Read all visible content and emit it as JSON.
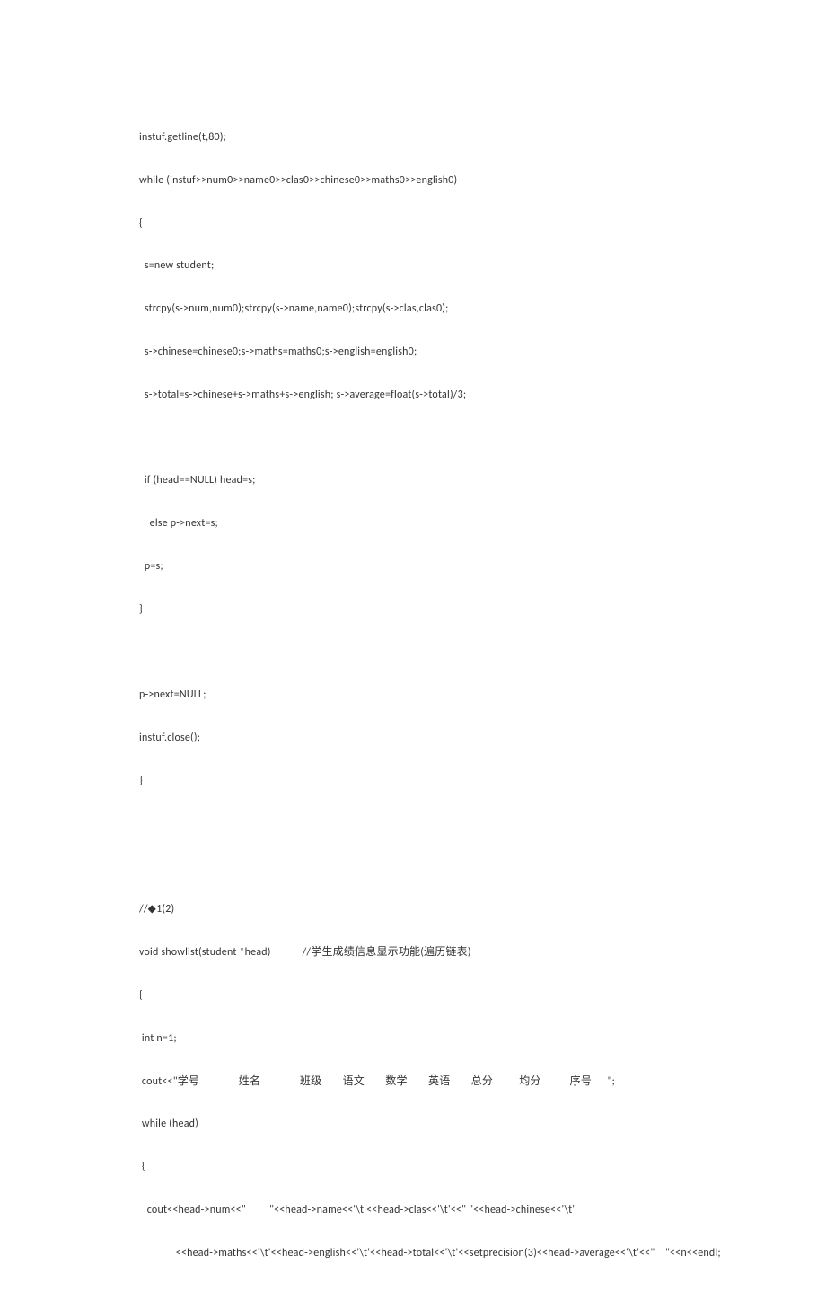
{
  "lines": [
    "instuf.getline(t,80);",
    "while (instuf>>num0>>name0>>clas0>>chinese0>>maths0>>english0)",
    "{",
    "  s=new student;",
    "  strcpy(s->num,num0);strcpy(s->name,name0);strcpy(s->clas,clas0);",
    "  s->chinese=chinese0;s->maths=maths0;s->english=english0;",
    "  s->total=s->chinese+s->maths+s->english; s->average=float(s->total)/3;",
    "",
    "  if (head==NULL) head=s;",
    "    else p->next=s;",
    "  p=s;",
    "}",
    "",
    "p->next=NULL;",
    "instuf.close();",
    "}",
    "",
    "",
    "//◆1(2)",
    "void showlist(student *head)            //学生成绩信息显示功能(遍历链表)",
    "{",
    " int n=1;",
    " cout<<\"学号               姓名               班级        语文        数学        英语        总分          均分           序号      \";",
    " while (head)",
    " {",
    "   cout<<head->num<<\"         \"<<head->name<<'\\t'<<head->clas<<'\\t'<<\" \"<<head->chinese<<'\\t'",
    "              <<head->maths<<'\\t'<<head->english<<'\\t'<<head->total<<'\\t'<<setprecision(3)<<head->average<<'\\t'<<\"    \"<<n<<endl;"
  ]
}
